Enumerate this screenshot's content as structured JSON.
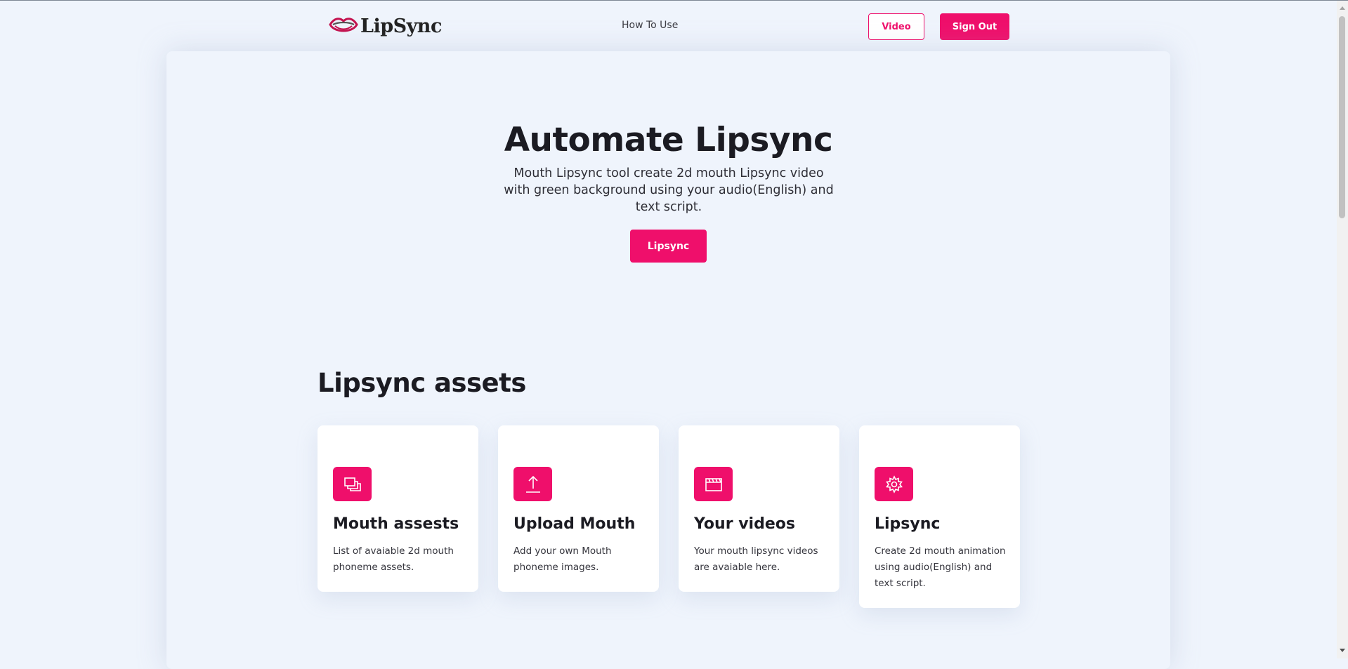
{
  "header": {
    "brand": "LipSync",
    "nav_how_to_use": "How To Use",
    "video_button": "Video",
    "sign_out_button": "Sign Out"
  },
  "hero": {
    "title": "Automate Lipsync",
    "description": "Mouth Lipsync tool create 2d mouth Lipsync video with green background using your audio(English) and text script.",
    "button": "Lipsync"
  },
  "assets_section": {
    "title": "Lipsync assets",
    "cards": [
      {
        "icon": "layers-icon",
        "title": "Mouth assests",
        "description": "List of avaiable 2d mouth phoneme assets."
      },
      {
        "icon": "upload-icon",
        "title": "Upload Mouth",
        "description": "Add your own Mouth phoneme images."
      },
      {
        "icon": "clapperboard-icon",
        "title": "Your videos",
        "description": "Your mouth lipsync videos are avaiable here."
      },
      {
        "icon": "gear-icon",
        "title": "Lipsync",
        "description": "Create 2d mouth animation using audio(English) and text script."
      }
    ]
  },
  "colors": {
    "accent": "#ef0f6b",
    "background": "#eff4fc",
    "card": "#ffffff",
    "text": "#1b1b22"
  }
}
